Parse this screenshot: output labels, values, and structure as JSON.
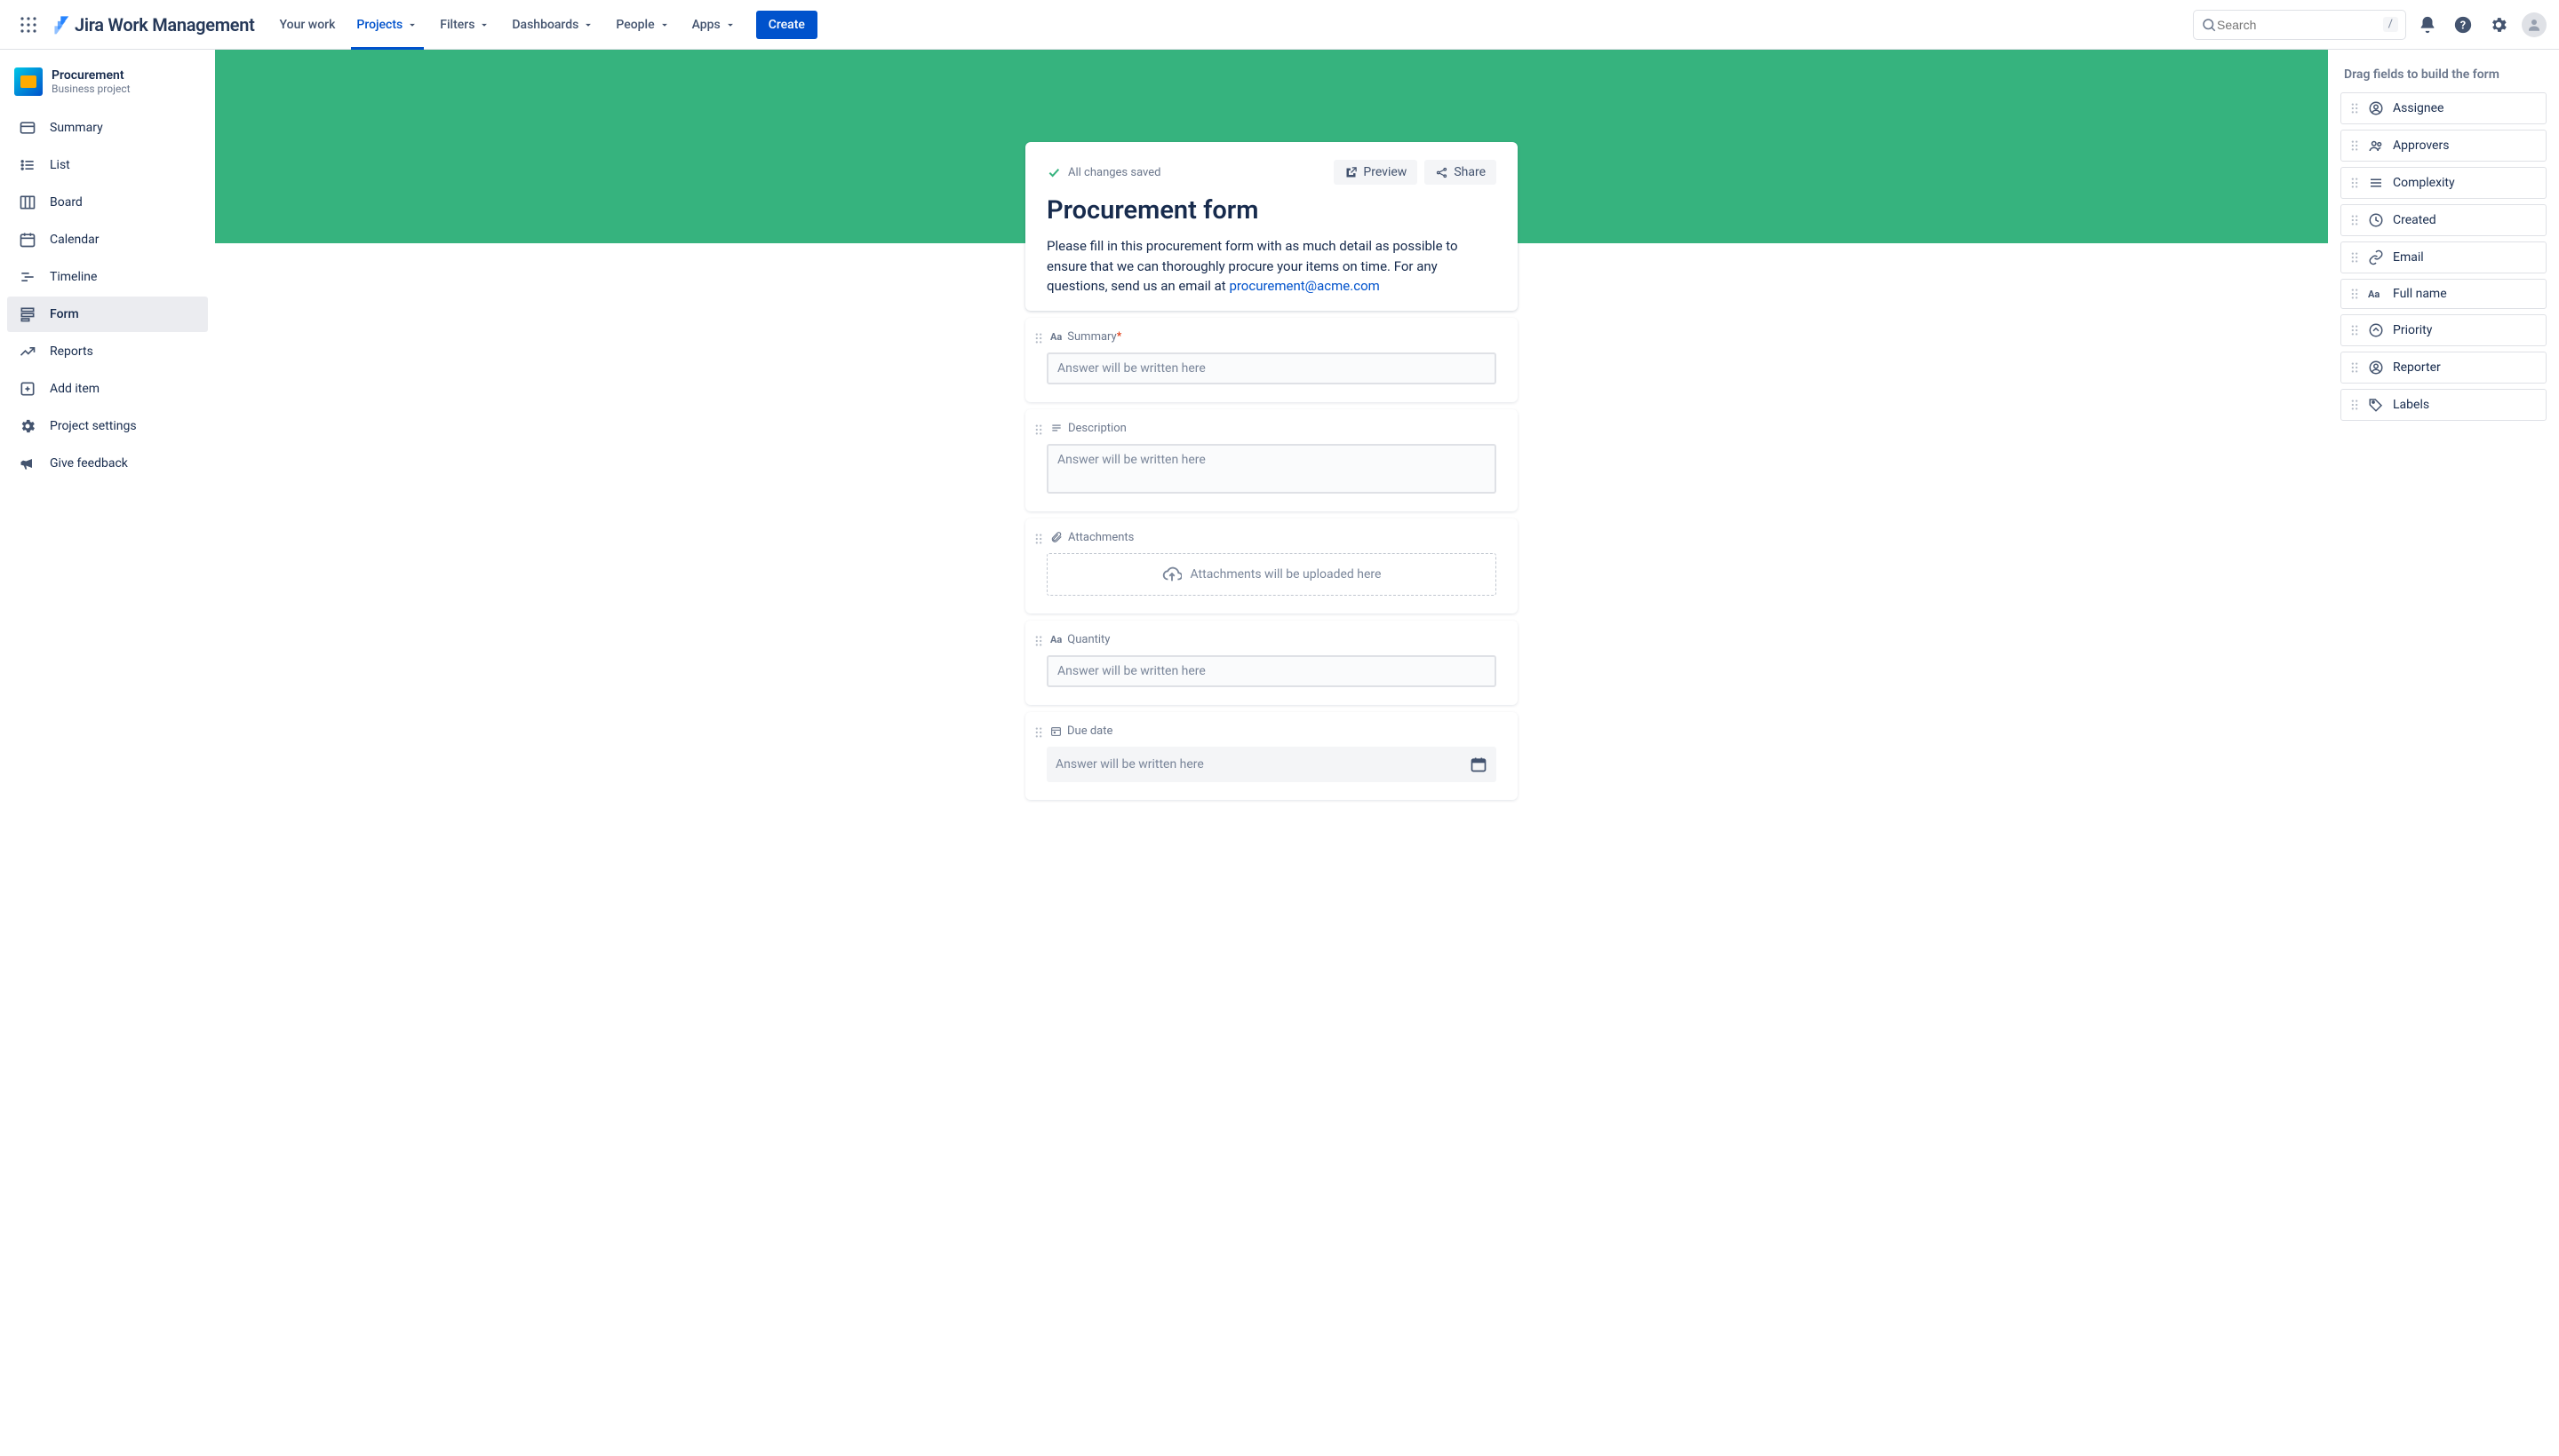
{
  "topnav": {
    "logo_text": "Jira Work Management",
    "items": [
      {
        "label": "Your work",
        "dropdown": false
      },
      {
        "label": "Projects",
        "dropdown": true,
        "active": true
      },
      {
        "label": "Filters",
        "dropdown": true
      },
      {
        "label": "Dashboards",
        "dropdown": true
      },
      {
        "label": "People",
        "dropdown": true
      },
      {
        "label": "Apps",
        "dropdown": true
      }
    ],
    "create_label": "Create",
    "search_placeholder": "Search",
    "search_keyhint": "/"
  },
  "project": {
    "name": "Procurement",
    "subtitle": "Business project"
  },
  "sidebar": {
    "items": [
      {
        "id": "summary",
        "label": "Summary",
        "icon": "card-icon"
      },
      {
        "id": "list",
        "label": "List",
        "icon": "list-icon"
      },
      {
        "id": "board",
        "label": "Board",
        "icon": "board-icon"
      },
      {
        "id": "calendar",
        "label": "Calendar",
        "icon": "calendar-icon"
      },
      {
        "id": "timeline",
        "label": "Timeline",
        "icon": "timeline-icon"
      },
      {
        "id": "form",
        "label": "Form",
        "icon": "form-icon",
        "selected": true
      },
      {
        "id": "reports",
        "label": "Reports",
        "icon": "reports-icon"
      },
      {
        "id": "additem",
        "label": "Add item",
        "icon": "add-icon"
      },
      {
        "id": "settings",
        "label": "Project settings",
        "icon": "gear-icon"
      },
      {
        "id": "feedback",
        "label": "Give feedback",
        "icon": "megaphone-icon"
      }
    ]
  },
  "form": {
    "saved_status": "All changes saved",
    "preview_label": "Preview",
    "share_label": "Share",
    "title": "Procurement form",
    "description_pre": "Please fill in this procurement form with as much detail as possible to ensure that we can thoroughly procure your items on time. For any questions, send us an email at ",
    "description_link": "procurement@acme.com",
    "answer_placeholder": "Answer will be written here",
    "attach_placeholder": "Attachments will be uploaded here",
    "fields": [
      {
        "id": "summary",
        "label": "Summary",
        "required": true,
        "type": "text",
        "icon": "Aa"
      },
      {
        "id": "description",
        "label": "Description",
        "type": "textarea",
        "icon": "paragraph"
      },
      {
        "id": "attachments",
        "label": "Attachments",
        "type": "attach",
        "icon": "clip"
      },
      {
        "id": "quantity",
        "label": "Quantity",
        "type": "text",
        "icon": "Aa"
      },
      {
        "id": "duedate",
        "label": "Due date",
        "type": "date",
        "icon": "date"
      }
    ]
  },
  "palette": {
    "title": "Drag fields to build the form",
    "items": [
      {
        "id": "assignee",
        "label": "Assignee",
        "icon": "person"
      },
      {
        "id": "approvers",
        "label": "Approvers",
        "icon": "people"
      },
      {
        "id": "complexity",
        "label": "Complexity",
        "icon": "list"
      },
      {
        "id": "created",
        "label": "Created",
        "icon": "clock"
      },
      {
        "id": "email",
        "label": "Email",
        "icon": "link"
      },
      {
        "id": "fullname",
        "label": "Full name",
        "icon": "Aa"
      },
      {
        "id": "priority",
        "label": "Priority",
        "icon": "priority"
      },
      {
        "id": "reporter",
        "label": "Reporter",
        "icon": "person"
      },
      {
        "id": "labels",
        "label": "Labels",
        "icon": "tag"
      }
    ]
  }
}
